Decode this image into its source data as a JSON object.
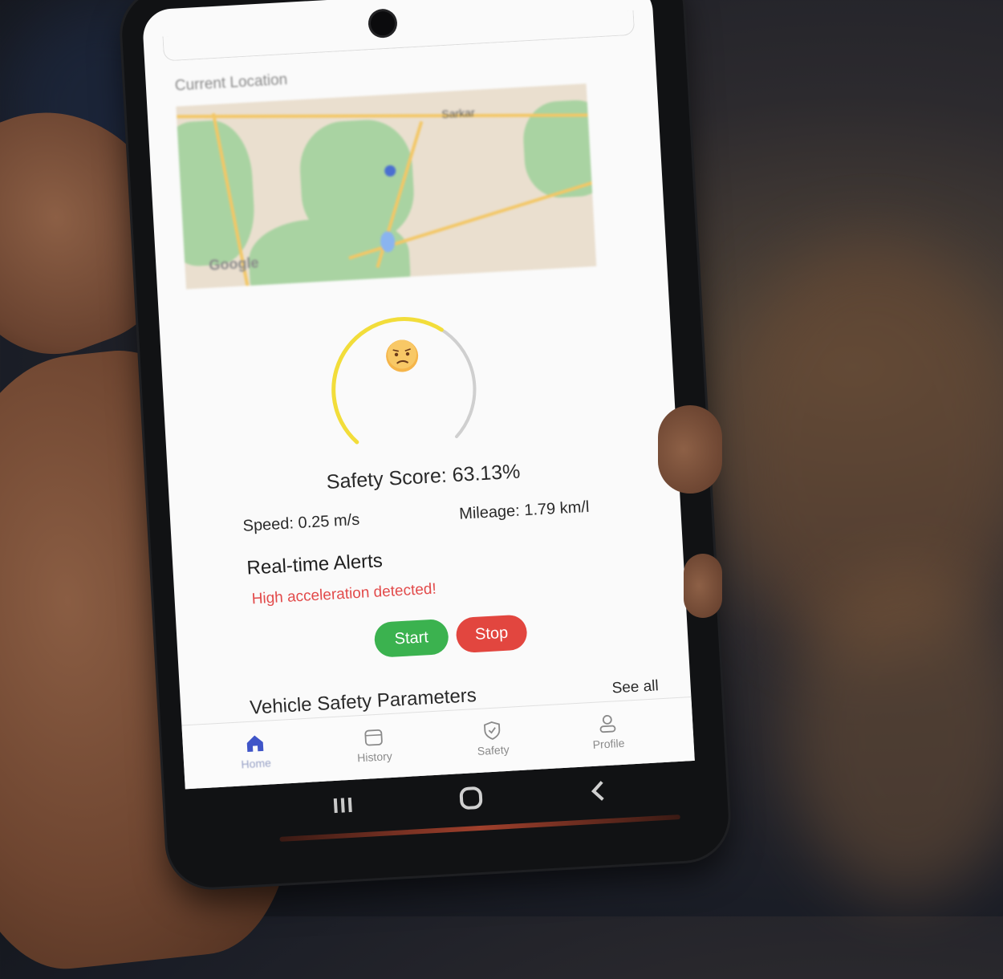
{
  "screen": {
    "location_title": "Current Location",
    "map": {
      "labels": [
        "Sarkar",
        "Google"
      ]
    },
    "gauge": {
      "score_fraction": 0.6313,
      "arc_color": "#f2dd3a",
      "track_color": "#cfcfcf",
      "emoji": "worried-face-icon"
    },
    "safety_score_text": "Safety Score: 63.13%",
    "speed_text": "Speed: 0.25 m/s",
    "mileage_text": "Mileage: 1.79 km/l",
    "alerts": {
      "title": "Real-time Alerts",
      "message": "High acceleration detected!",
      "message_color": "#e24a4a"
    },
    "buttons": {
      "start": "Start",
      "stop": "Stop",
      "start_color": "#3bb24f",
      "stop_color": "#e2463f"
    },
    "section": {
      "title": "Vehicle Safety Parameters",
      "see_all": "See all"
    },
    "bottom_nav": [
      {
        "label": "Home",
        "icon": "home-icon",
        "active": true
      },
      {
        "label": "History",
        "icon": "calendar-icon",
        "active": false
      },
      {
        "label": "Safety",
        "icon": "shield-icon",
        "active": false
      },
      {
        "label": "Profile",
        "icon": "user-icon",
        "active": false
      }
    ],
    "system_nav": [
      "recents-icon",
      "home-circle-icon",
      "back-icon"
    ]
  }
}
